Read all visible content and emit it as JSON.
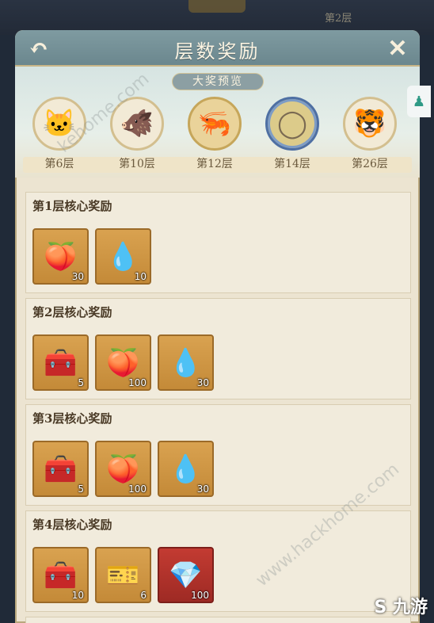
{
  "header": {
    "title": "层数奖励"
  },
  "preview": {
    "label": "大奖预览",
    "prizes": [
      {
        "floor": "第6层",
        "icon": "cat-icon"
      },
      {
        "floor": "第10层",
        "icon": "boar-icon"
      },
      {
        "floor": "第12层",
        "icon": "shrimp-icon"
      },
      {
        "floor": "第14层",
        "icon": "ring-frame-icon"
      },
      {
        "floor": "第26层",
        "icon": "tiger-icon"
      }
    ]
  },
  "sections": [
    {
      "title": "第1层核心奖励",
      "items": [
        {
          "icon": "peach-icon",
          "count": "30"
        },
        {
          "icon": "water-gourd-icon",
          "count": "10"
        }
      ]
    },
    {
      "title": "第2层核心奖励",
      "items": [
        {
          "icon": "treasure-chest-icon",
          "count": "5"
        },
        {
          "icon": "peach-icon",
          "count": "100"
        },
        {
          "icon": "water-gourd-icon",
          "count": "30"
        }
      ]
    },
    {
      "title": "第3层核心奖励",
      "items": [
        {
          "icon": "treasure-chest-icon",
          "count": "5"
        },
        {
          "icon": "peach-icon",
          "count": "100"
        },
        {
          "icon": "water-gourd-icon",
          "count": "30"
        }
      ]
    },
    {
      "title": "第4层核心奖励",
      "items": [
        {
          "icon": "treasure-chest-icon",
          "count": "10"
        },
        {
          "icon": "talisman-ticket-icon",
          "count": "6"
        },
        {
          "icon": "jade-crystal-icon",
          "count": "100"
        }
      ]
    }
  ],
  "background": {
    "floor_hint": "第2层"
  },
  "watermarks": [
    "www.hackhome.com",
    "kehome.com"
  ],
  "brand": "九游"
}
